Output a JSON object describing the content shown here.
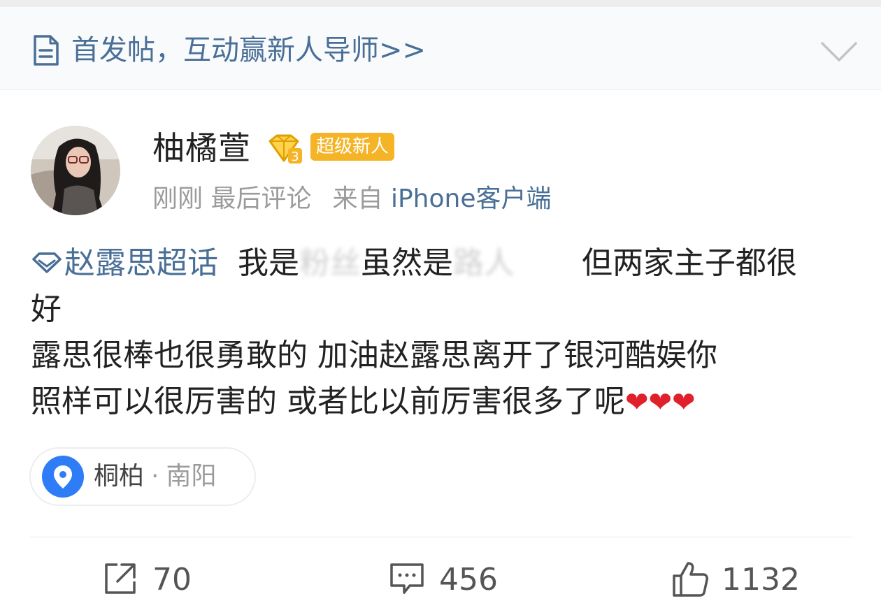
{
  "notice": {
    "text": "首发帖，互动赢新人导师>>",
    "icon": "document-icon",
    "collapse_icon": "chevron-down-icon"
  },
  "user": {
    "name": "柚橘萱",
    "vip_icon": "diamond-level-icon",
    "badge": "超级新人",
    "time": "刚刚",
    "last_comment": "最后评论",
    "source_prefix": "来自",
    "source": "iPhone客户端"
  },
  "post": {
    "topic": "赵露思超话",
    "line1_a": "我是",
    "line1_blur1": "粉丝",
    "line1_b": "虽然是",
    "line1_blur2": "路人",
    "line1_c": "但两家主子都很",
    "line2": "好",
    "line3": "露思很棒也很勇敢的  加油赵露思离开了银河酷娱你",
    "line4": "照样可以很厉害的 或者比以前厉害很多了呢",
    "hearts": "❤❤❤"
  },
  "location": {
    "place": "桐柏",
    "separator": "·",
    "city": "南阳"
  },
  "actions": {
    "reposts": "70",
    "comments": "456",
    "likes": "1132"
  },
  "colors": {
    "link_blue": "#4a6f97",
    "badge_orange": "#f5b426",
    "pin_blue": "#2f7df6",
    "heart_red": "#e0202a"
  }
}
